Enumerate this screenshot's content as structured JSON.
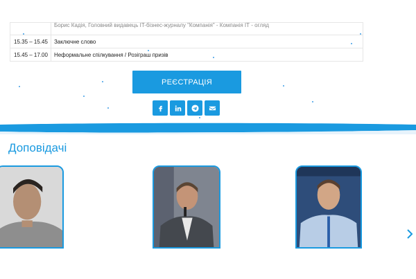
{
  "schedule": {
    "rows": [
      {
        "time": "",
        "text": "Борис Кадія, Головний видавець IT-бізнес-журналу \"Компанія\" - Компанія ІТ - огляд"
      },
      {
        "time": "15.35 – 15.45",
        "text": "Заключне слово"
      },
      {
        "time": "15.45 – 17.00",
        "text": "Неформальне спілкування / Розіграш призів"
      }
    ]
  },
  "register": {
    "label": "РЕЄСТРАЦІЯ"
  },
  "social": [
    {
      "icon": "facebook-icon"
    },
    {
      "icon": "linkedin-icon"
    },
    {
      "icon": "telegram-icon"
    },
    {
      "icon": "email-icon"
    }
  ],
  "speakers_section": {
    "title": "Доповідачі"
  },
  "colors": {
    "accent": "#1a9ae0",
    "table_border": "#e6e6e6"
  }
}
